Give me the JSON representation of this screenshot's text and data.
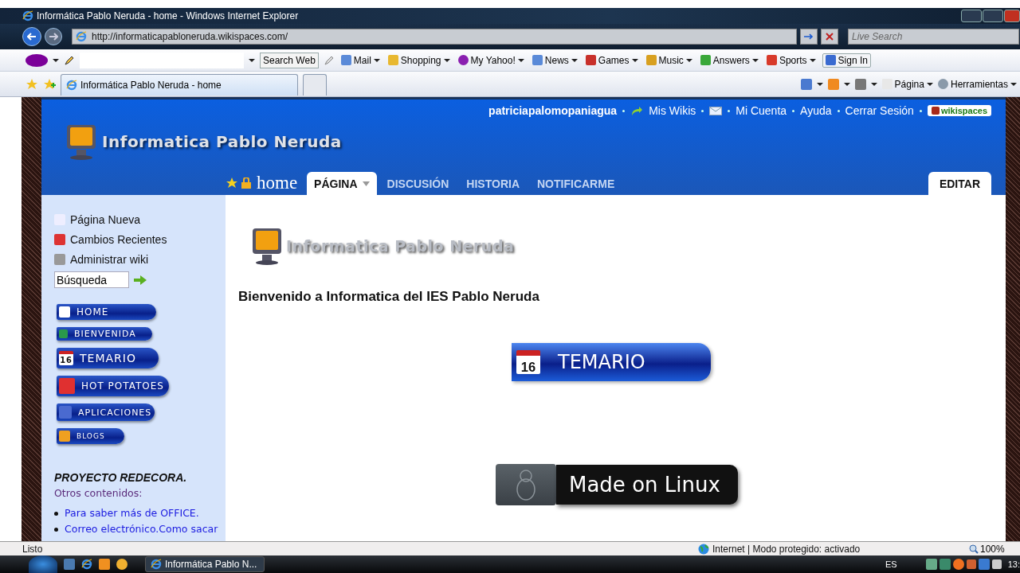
{
  "window": {
    "title": "Informática Pablo Neruda - home - Windows Internet Explorer"
  },
  "address_bar": {
    "url": "http://informaticapabloneruda.wikispaces.com/",
    "search_placeholder": "Live Search"
  },
  "yahoo_toolbar": {
    "search_button": "Search Web",
    "items": [
      {
        "label": "Mail"
      },
      {
        "label": "Shopping"
      },
      {
        "label": "My Yahoo!"
      },
      {
        "label": "News"
      },
      {
        "label": "Games"
      },
      {
        "label": "Music"
      },
      {
        "label": "Answers"
      },
      {
        "label": "Sports"
      }
    ],
    "sign_in": "Sign In"
  },
  "tabs": [
    {
      "label": "Informática Pablo Neruda - home",
      "selected": true
    }
  ],
  "command_bar": [
    "Página",
    "Herramientas"
  ],
  "site": {
    "logo_text": "Informatica Pablo Neruda",
    "user": "patriciapalomopaniagua",
    "user_links": [
      "Mis Wikis",
      "Mi Cuenta",
      "Ayuda",
      "Cerrar Sesión"
    ],
    "brand_badge": "wikispaces",
    "page_title": "home",
    "page_tabs": [
      {
        "label": "PÁGINA",
        "selected": true
      },
      {
        "label": "DISCUSIÓN",
        "selected": false
      },
      {
        "label": "HISTORIA",
        "selected": false
      },
      {
        "label": "NOTIFICARME",
        "selected": false
      }
    ],
    "edit_button": "EDITAR"
  },
  "sidebar": {
    "links": [
      "Página Nueva",
      "Cambios Recientes",
      "Administrar wiki"
    ],
    "search_value": "Búsqueda",
    "nav_buttons": [
      {
        "label": "HOME"
      },
      {
        "label": "BIENVENIDA"
      },
      {
        "label": "TEMARIO",
        "icon_text": "16"
      },
      {
        "label": "HOT POTATOES"
      },
      {
        "label": "APLICACIONES"
      },
      {
        "label": "BLOGS"
      }
    ],
    "section_title": "PROYECTO REDECORA.",
    "section_subtitle": "Otros contenidos:",
    "section_links": [
      "Para saber más de OFFICE.",
      "Correo electrónico.Como sacar"
    ]
  },
  "content": {
    "logo_text": "Informatica Pablo Neruda",
    "heading": "Bienvenido a Informatica del IES Pablo Neruda",
    "banner": {
      "label": "TEMARIO",
      "icon_text": "16"
    },
    "badge": "Made on Linux"
  },
  "status_bar": {
    "status": "Listo",
    "zone": "Internet | Modo protegido: activado",
    "zoom": "100%"
  },
  "taskbar": {
    "window": "Informática Pablo N...",
    "language": "ES",
    "clock": "13:"
  }
}
